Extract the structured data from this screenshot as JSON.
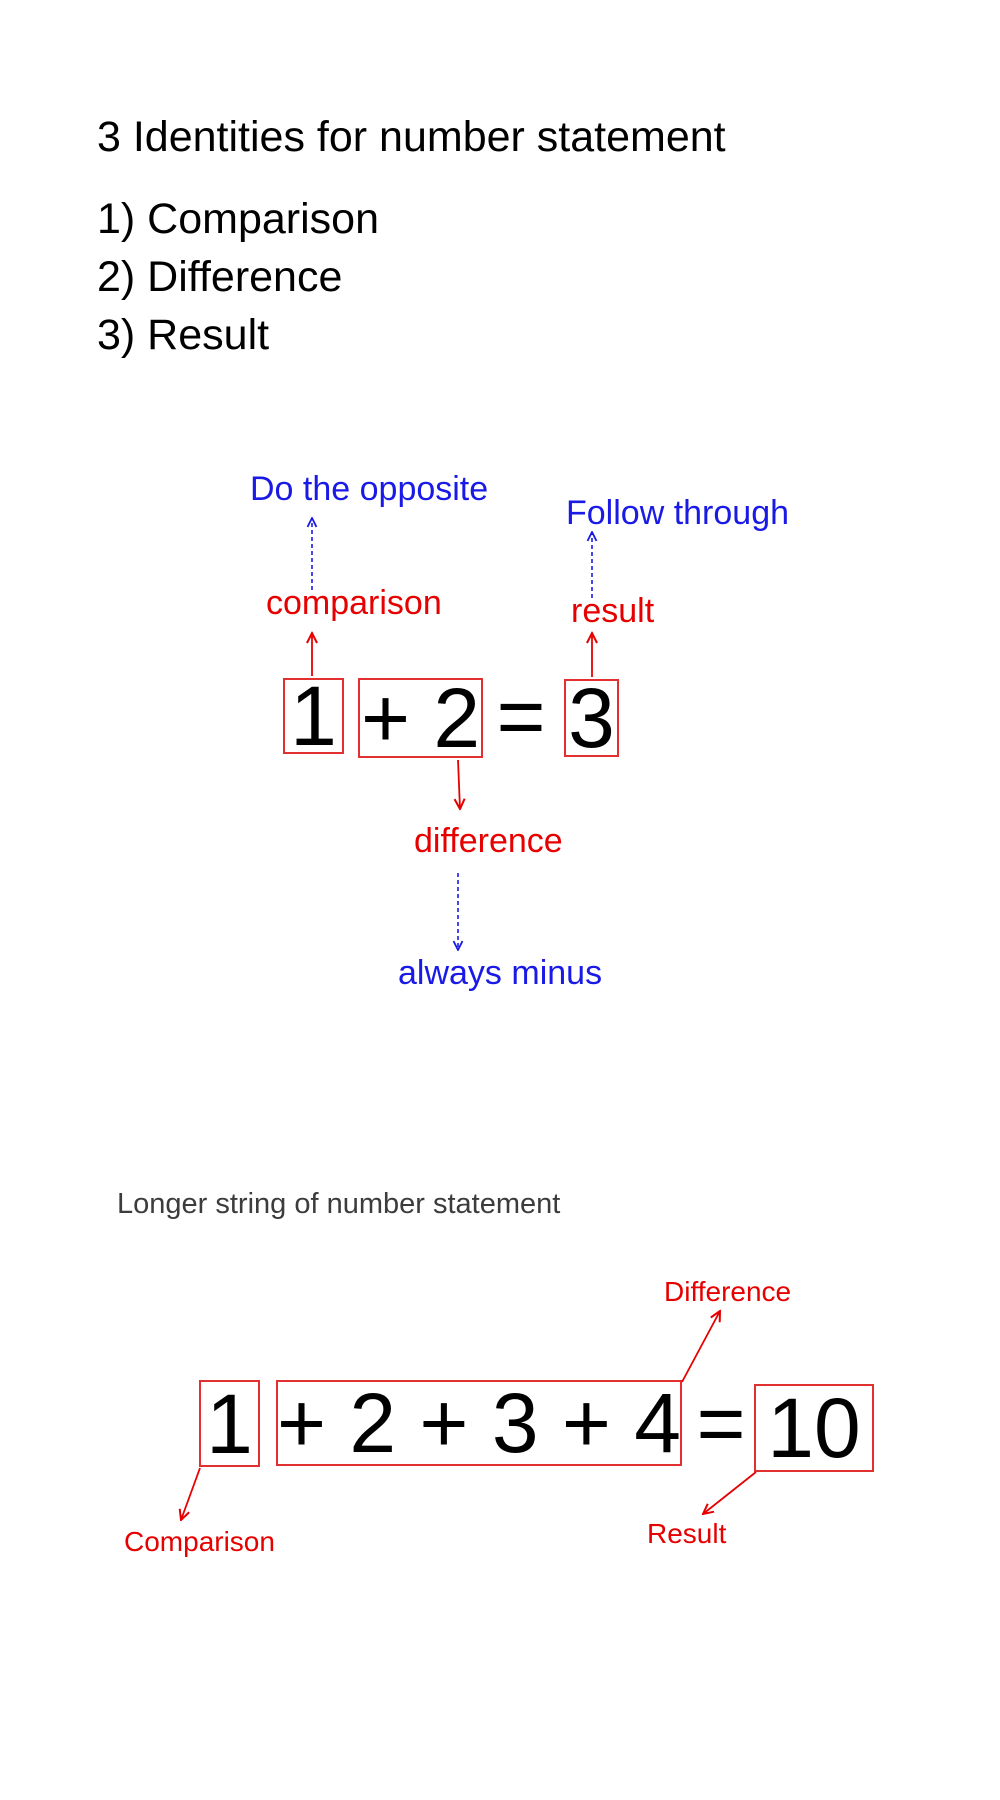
{
  "title": "3 Identities for number statement",
  "identities": [
    "1) Comparison",
    "2) Difference",
    "3) Result"
  ],
  "example1": {
    "terms": {
      "comparison": "1",
      "difference": "+ 2",
      "equals": "=",
      "result": "3"
    },
    "labels": {
      "comparison": "comparison",
      "difference": "difference",
      "result": "result"
    },
    "notes": {
      "comparison": "Do the opposite",
      "difference": "always minus",
      "result": "Follow through"
    }
  },
  "example2": {
    "heading": "Longer string of number statement",
    "terms": {
      "comparison": "1",
      "difference": "+ 2 + 3 + 4",
      "equals": "=",
      "result": "10"
    },
    "labels": {
      "comparison": "Comparison",
      "difference": "Difference",
      "result": "Result"
    }
  },
  "colors": {
    "identity_label": "#e60000",
    "strategy_note": "#1a1ae6",
    "box_outline": "#e23030"
  }
}
